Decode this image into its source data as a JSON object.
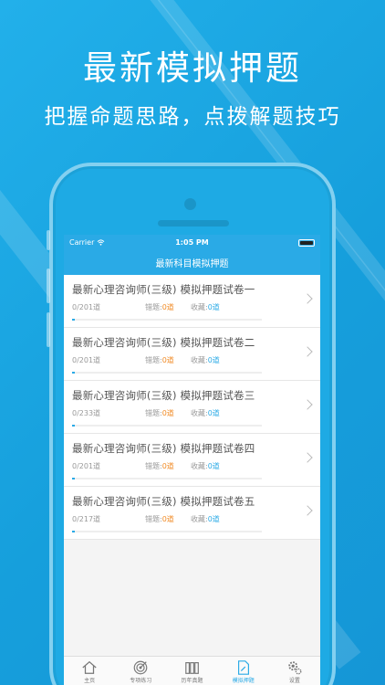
{
  "headline": "最新模拟押题",
  "subline": "把握命题思路，点拨解题技巧",
  "status": {
    "carrier": "Carrier",
    "time": "1:05 PM"
  },
  "nav_title": "最新科目模拟押题",
  "papers": [
    {
      "title": "最新心理咨询师(三级) 模拟押题试卷一",
      "count": "0/201道",
      "wrong_label": "错题:",
      "wrong": "0道",
      "fav_label": "收藏:",
      "fav": "0道",
      "progress": 0.0
    },
    {
      "title": "最新心理咨询师(三级) 模拟押题试卷二",
      "count": "0/201道",
      "wrong_label": "错题:",
      "wrong": "0道",
      "fav_label": "收藏:",
      "fav": "0道",
      "progress": 0.0
    },
    {
      "title": "最新心理咨询师(三级) 模拟押题试卷三",
      "count": "0/233道",
      "wrong_label": "错题:",
      "wrong": "0道",
      "fav_label": "收藏:",
      "fav": "0道",
      "progress": 0.0
    },
    {
      "title": "最新心理咨询师(三级) 模拟押题试卷四",
      "count": "0/201道",
      "wrong_label": "错题:",
      "wrong": "0道",
      "fav_label": "收藏:",
      "fav": "0道",
      "progress": 0.0
    },
    {
      "title": "最新心理咨询师(三级) 模拟押题试卷五",
      "count": "0/217道",
      "wrong_label": "错题:",
      "wrong": "0道",
      "fav_label": "收藏:",
      "fav": "0道",
      "progress": 0.0
    }
  ],
  "tabs": [
    {
      "label": "主页",
      "icon": "home-icon",
      "active": false
    },
    {
      "label": "专项练习",
      "icon": "target-icon",
      "active": false
    },
    {
      "label": "历年真题",
      "icon": "books-icon",
      "active": false
    },
    {
      "label": "模拟押题",
      "icon": "document-edit-icon",
      "active": true
    },
    {
      "label": "设置",
      "icon": "gears-icon",
      "active": false
    }
  ],
  "colors": {
    "accent": "#2aaae6",
    "warning": "#f08a24",
    "background": "#1aa6e0"
  }
}
